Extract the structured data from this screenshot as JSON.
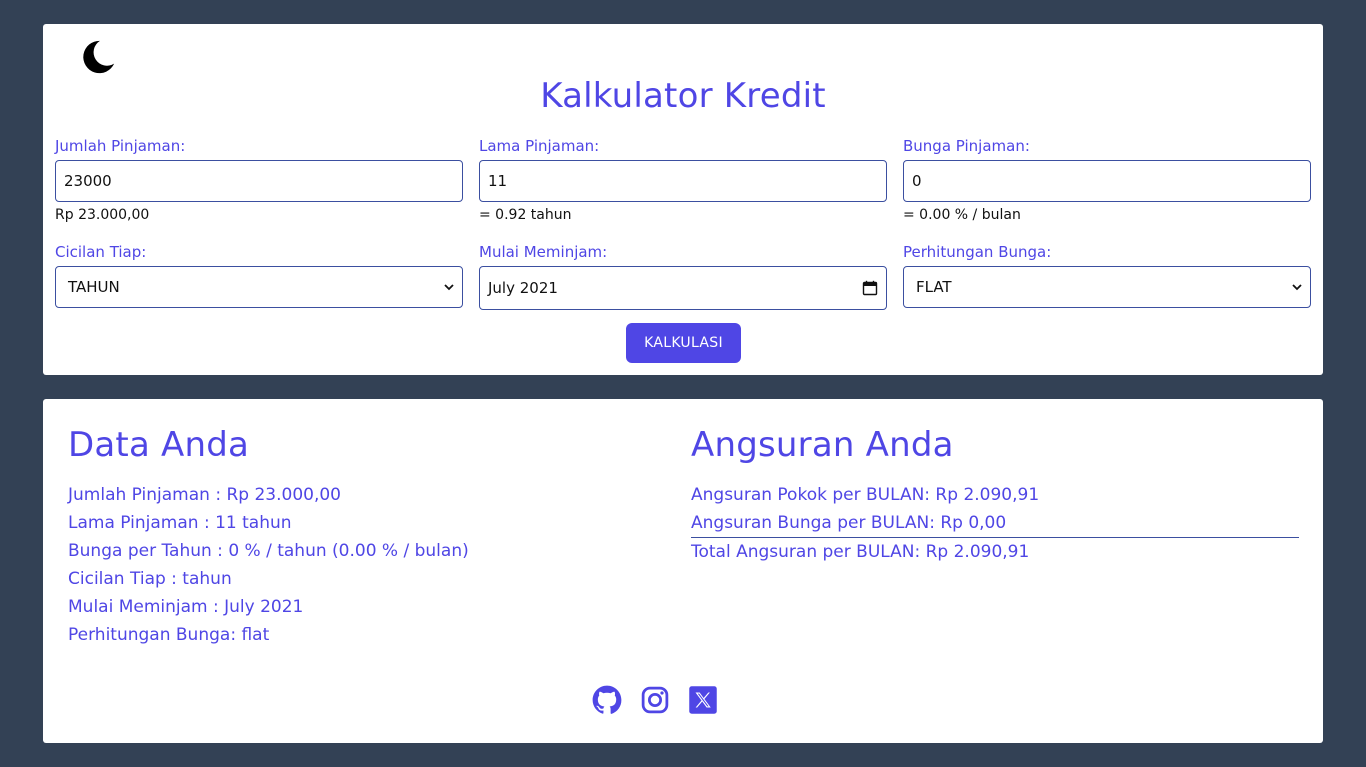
{
  "form": {
    "title": "Kalkulator Kredit",
    "jumlah": {
      "label": "Jumlah Pinjaman:",
      "value": "23000",
      "hint": "Rp 23.000,00"
    },
    "lama": {
      "label": "Lama Pinjaman:",
      "value": "11",
      "hint": "= 0.92 tahun"
    },
    "bunga": {
      "label": "Bunga Pinjaman:",
      "value": "0",
      "hint": "= 0.00 % / bulan"
    },
    "cicilan": {
      "label": "Cicilan Tiap:",
      "value": "TAHUN"
    },
    "mulai": {
      "label": "Mulai Meminjam:",
      "value": "July 2021"
    },
    "perhitungan": {
      "label": "Perhitungan Bunga:",
      "value": "FLAT"
    },
    "submit_label": "KALKULASI"
  },
  "data_anda": {
    "heading": "Data Anda",
    "lines": [
      "Jumlah Pinjaman : Rp 23.000,00",
      "Lama Pinjaman : 11 tahun",
      "Bunga per Tahun : 0 % / tahun (0.00 % / bulan)",
      "Cicilan Tiap : tahun",
      "Mulai Meminjam : July 2021",
      "Perhitungan Bunga: flat"
    ]
  },
  "angsuran": {
    "heading": "Angsuran Anda",
    "pokok": "Angsuran Pokok per BULAN: Rp 2.090,91",
    "bunga": "Angsuran Bunga per BULAN: Rp 0,00",
    "total": "Total Angsuran per BULAN: Rp 2.090,91"
  },
  "icons": {
    "theme": "moon-icon",
    "socials": [
      "github-icon",
      "instagram-icon",
      "x-icon"
    ]
  },
  "colors": {
    "background": "#334155",
    "accent": "#4f46e5",
    "card": "#ffffff"
  }
}
